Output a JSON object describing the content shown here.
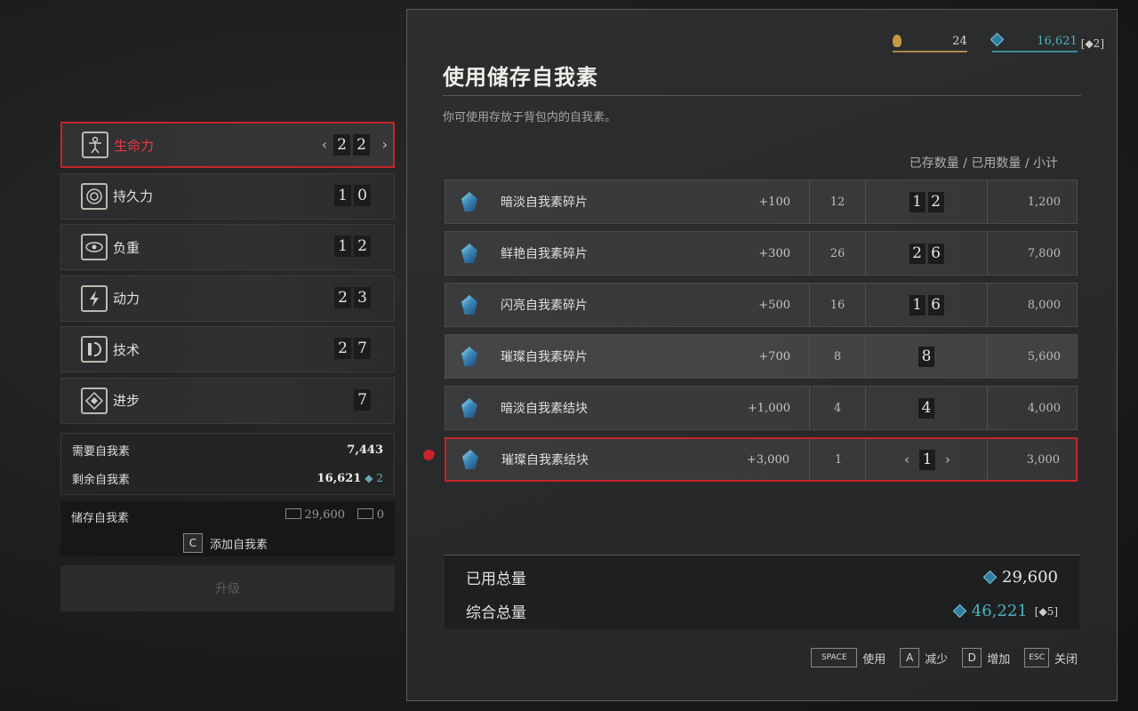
{
  "stats": [
    {
      "label": "生命力",
      "digits": [
        "2",
        "2"
      ],
      "active": true
    },
    {
      "label": "持久力",
      "digits": [
        "1",
        "0"
      ]
    },
    {
      "label": "负重",
      "digits": [
        "1",
        "2"
      ]
    },
    {
      "label": "动力",
      "digits": [
        "2",
        "3"
      ]
    },
    {
      "label": "技术",
      "digits": [
        "2",
        "7"
      ]
    },
    {
      "label": "进步",
      "digits": [
        "7"
      ]
    }
  ],
  "summary": {
    "need_label": "需要自我素",
    "need_value": "7,443",
    "remain_label": "剩余自我素",
    "remain_value": "16,621",
    "remain_gem": "2"
  },
  "storage": {
    "label": "储存自我素",
    "value1": "29,600",
    "value2": "0",
    "add_key": "C",
    "add_label": "添加自我素"
  },
  "upgrade_label": "升级",
  "hud": {
    "flame_count": "24",
    "ergo": "16,621",
    "gem": "2"
  },
  "dialog": {
    "title": "使用储存自我素",
    "subtitle": "你可使用存放于背包内的自我素。",
    "column_header": "已存数量 / 已用数量 / 小计"
  },
  "items": [
    {
      "name": "暗淡自我素碎片",
      "bonus": "+100",
      "have": "12",
      "use": [
        "1",
        "2"
      ],
      "subtotal": "1,200"
    },
    {
      "name": "鲜艳自我素碎片",
      "bonus": "+300",
      "have": "26",
      "use": [
        "2",
        "6"
      ],
      "subtotal": "7,800"
    },
    {
      "name": "闪亮自我素碎片",
      "bonus": "+500",
      "have": "16",
      "use": [
        "1",
        "6"
      ],
      "subtotal": "8,000"
    },
    {
      "name": "璀璨自我素碎片",
      "bonus": "+700",
      "have": "8",
      "use": [
        "8"
      ],
      "subtotal": "5,600",
      "highlight": true
    },
    {
      "name": "暗淡自我素结块",
      "bonus": "+1,000",
      "have": "4",
      "use": [
        "4"
      ],
      "subtotal": "4,000"
    },
    {
      "name": "璀璨自我素结块",
      "bonus": "+3,000",
      "have": "1",
      "use": [
        "1"
      ],
      "subtotal": "3,000",
      "selected": true
    }
  ],
  "totals": {
    "used_label": "已用总量",
    "used_value": "29,600",
    "combined_label": "综合总量",
    "combined_value": "46,221",
    "combined_gem": "5"
  },
  "hints": [
    {
      "key": "SPACE",
      "label": "使用"
    },
    {
      "key": "A",
      "label": "减少"
    },
    {
      "key": "D",
      "label": "增加"
    },
    {
      "key": "ESC",
      "label": "关闭"
    }
  ],
  "colors": {
    "accent_red": "#c8232c",
    "ergo_cyan": "#4fb3bd",
    "gold": "#a88a4a"
  },
  "icons": {
    "arrow_left": "‹",
    "arrow_right": "›",
    "gem_glyph": "◆"
  }
}
